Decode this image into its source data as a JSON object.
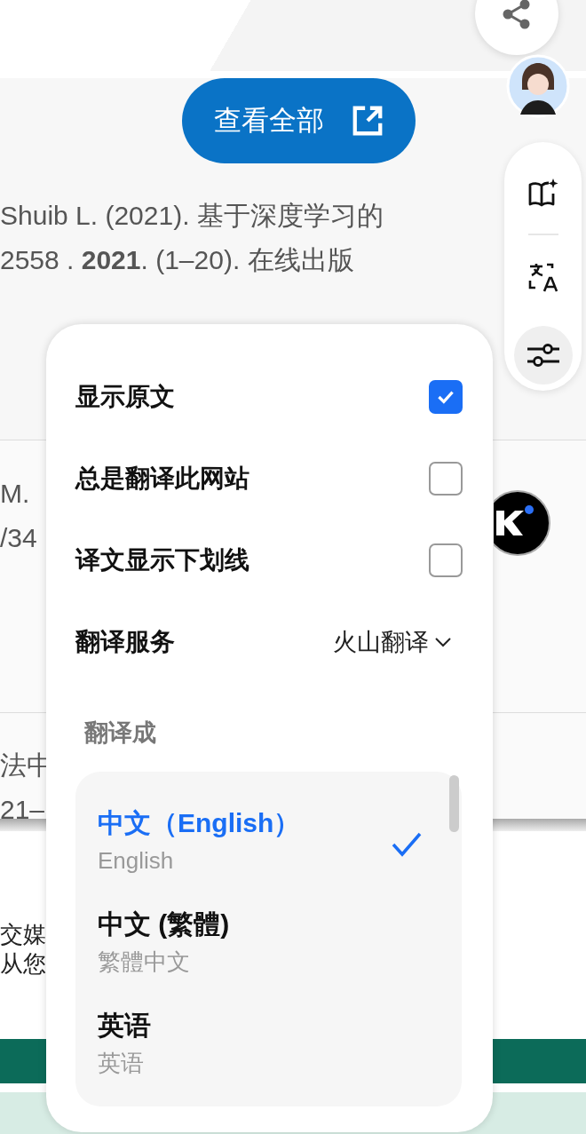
{
  "page": {
    "view_all_button": "查看全部",
    "citation_lines": [
      "Shuib L. (2021). 基于深度学习的",
      "2558 . **2021**. (1–20). 在线出版"
    ],
    "entry_lines": [
      "M.",
      "/34"
    ],
    "entry2_lines": [
      "法中",
      "21–"
    ],
    "notice_lines": [
      "交媒",
      "从您"
    ]
  },
  "toolbar": {
    "tools": [
      {
        "kind": "book",
        "selected": false
      },
      {
        "kind": "translate",
        "selected": false
      },
      {
        "kind": "settings",
        "selected": true
      }
    ]
  },
  "settings_panel": {
    "options": [
      {
        "label": "显示原文",
        "checked": true
      },
      {
        "label": "总是翻译此网站",
        "checked": false
      },
      {
        "label": "译文显示下划线",
        "checked": false
      }
    ],
    "service": {
      "label": "翻译服务",
      "value": "火山翻译"
    },
    "target_label": "翻译成",
    "languages": [
      {
        "name": "中文（English）",
        "native": "English",
        "selected": true
      },
      {
        "name": "中文 (繁體)",
        "native": "繁體中文",
        "selected": false
      },
      {
        "name": "英语",
        "native": "英语",
        "selected": false
      }
    ]
  }
}
